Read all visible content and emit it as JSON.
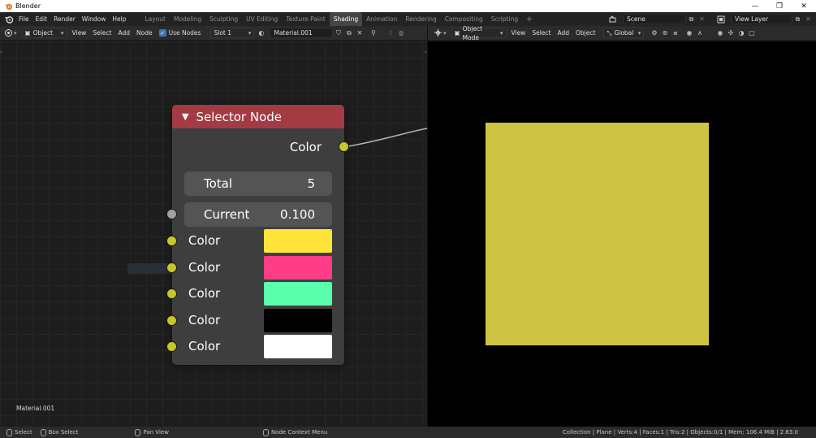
{
  "window": {
    "title": "Blender",
    "buttons": [
      "—",
      "❐",
      "✕"
    ]
  },
  "menu": [
    "File",
    "Edit",
    "Render",
    "Window",
    "Help"
  ],
  "workspaces": [
    {
      "label": "Layout",
      "active": false
    },
    {
      "label": "Modeling",
      "active": false
    },
    {
      "label": "Sculpting",
      "active": false
    },
    {
      "label": "UV Editing",
      "active": false
    },
    {
      "label": "Texture Paint",
      "active": false
    },
    {
      "label": "Shading",
      "active": true
    },
    {
      "label": "Animation",
      "active": false
    },
    {
      "label": "Rendering",
      "active": false
    },
    {
      "label": "Compositing",
      "active": false
    },
    {
      "label": "Scripting",
      "active": false
    }
  ],
  "scene": {
    "value": "Scene"
  },
  "view_layer": {
    "value": "View Layer"
  },
  "node_header": {
    "object_mode": "Object",
    "view": "View",
    "select": "Select",
    "add": "Add",
    "node": "Node",
    "use_nodes": "Use Nodes",
    "slot": "Slot 1",
    "material": "Material.001"
  },
  "viewport_header": {
    "mode": "Object Mode",
    "view": "View",
    "select": "Select",
    "add": "Add",
    "object": "Object",
    "orientation": "Global"
  },
  "node": {
    "title": "Selector Node",
    "output_label": "Color",
    "total_label": "Total",
    "total_value": "5",
    "current_label": "Current",
    "current_value": "0.100",
    "colors": [
      {
        "label": "Color",
        "swatch": "#ffe43a"
      },
      {
        "label": "Color",
        "swatch": "#ff3d86"
      },
      {
        "label": "Color",
        "swatch": "#5affab"
      },
      {
        "label": "Color",
        "swatch": "#000000"
      },
      {
        "label": "Color",
        "swatch": "#ffffff"
      }
    ],
    "header_color": "#a43a44"
  },
  "editor": {
    "material_label": "Material.001"
  },
  "viewport": {
    "plane_color": "#cdc444"
  },
  "statusbar": {
    "select": "Select",
    "box_select": "Box Select",
    "pan_view": "Pan View",
    "context_menu": "Node Context Menu",
    "stats": "Collection | Plane | Verts:4 | Faces:1 | Tris:2 | Objects:0/1 | Mem: 106.4 MiB | 2.83.0"
  }
}
